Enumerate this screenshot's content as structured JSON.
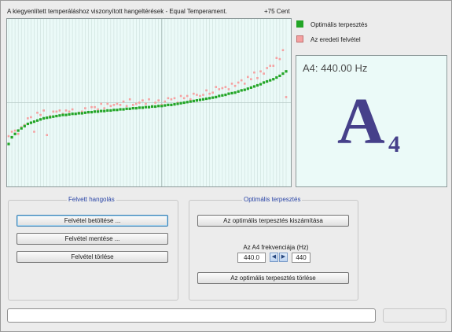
{
  "chart_header": {
    "title": "A kiegyenlített temperáláshoz viszonyított hangeltérések - Equal Temperament.",
    "range_label": "+75 Cent"
  },
  "legend": [
    {
      "label": "Optimális terpesztés",
      "color": "#22a526"
    },
    {
      "label": "Az eredeti felvétel",
      "color": "#f5a0a0"
    }
  ],
  "note_display": {
    "frequency": "A4: 440.00 Hz",
    "letter": "A",
    "octave": "4"
  },
  "recorded_tuning": {
    "legend": "Felvett hangolás",
    "load_button": "Felvétel betöltése ...",
    "save_button": "Felvétel mentése ...",
    "delete_button": "Felvétel törlése"
  },
  "optimal_stretch": {
    "legend": "Optimális terpesztés",
    "calc_button": "Az optimális terpesztés kiszámítása",
    "freq_label": "Az A4 frekvenciája (Hz)",
    "freq_value": "440.0",
    "freq_value_right": "440",
    "delete_button": "Az optimális terpesztés törlése"
  },
  "chart_data": {
    "type": "scatter",
    "title": "A kiegyenlített temperáláshoz viszonyított hangeltérések - Equal Temperament.",
    "ymax_label": "+75 Cent",
    "y_unit": "cent",
    "ylim": [
      -75,
      75
    ],
    "reference_key": 49,
    "x": [
      1,
      2,
      3,
      4,
      5,
      6,
      7,
      8,
      9,
      10,
      11,
      12,
      13,
      14,
      15,
      16,
      17,
      18,
      19,
      20,
      21,
      22,
      23,
      24,
      25,
      26,
      27,
      28,
      29,
      30,
      31,
      32,
      33,
      34,
      35,
      36,
      37,
      38,
      39,
      40,
      41,
      42,
      43,
      44,
      45,
      46,
      47,
      48,
      49,
      50,
      51,
      52,
      53,
      54,
      55,
      56,
      57,
      58,
      59,
      60,
      61,
      62,
      63,
      64,
      65,
      66,
      67,
      68,
      69,
      70,
      71,
      72,
      73,
      74,
      75,
      76,
      77,
      78,
      79,
      80,
      81,
      82,
      83,
      84,
      85,
      86,
      87,
      88
    ],
    "series": [
      {
        "name": "Optimális terpesztés",
        "color": "#22a526",
        "values": [
          -37,
          -31,
          -28,
          -25,
          -23,
          -21,
          -19,
          -18,
          -17,
          -16,
          -15,
          -14,
          -13.5,
          -13,
          -12.5,
          -12,
          -11.5,
          -11,
          -11,
          -10.5,
          -10,
          -10,
          -9.5,
          -9.5,
          -9,
          -8.5,
          -8.5,
          -8,
          -8,
          -7.5,
          -7.5,
          -7,
          -7,
          -6.5,
          -6.5,
          -6,
          -6,
          -5.5,
          -5.5,
          -5,
          -5,
          -4.5,
          -4.5,
          -4,
          -4,
          -3.5,
          -3.5,
          -3,
          -3,
          -2.5,
          -2,
          -2,
          -1.5,
          -1,
          -0.5,
          0,
          0.5,
          1,
          1.5,
          2,
          2.5,
          3,
          3.5,
          4,
          4.5,
          5,
          6,
          6.5,
          7,
          8,
          8.5,
          9,
          10,
          11,
          11.5,
          12.5,
          13.5,
          14.5,
          15.5,
          16.5,
          18,
          19,
          20,
          21,
          22.5,
          24,
          26,
          28
        ]
      },
      {
        "name": "Az eredeti felvétel",
        "color": "#f5a0a0",
        "values": [
          -30,
          -26,
          -25,
          -28,
          -22,
          -20,
          -14,
          -13,
          -26,
          -9,
          -11,
          -7,
          -29,
          -12,
          -8,
          -8,
          -7,
          -10,
          -7,
          -8,
          -6,
          -10,
          -9,
          -8,
          -5,
          -9,
          -4,
          -4,
          -6,
          -1,
          -5,
          -1,
          -3,
          -2,
          -1,
          -2,
          1,
          -3,
          3,
          -2,
          -1,
          0,
          2,
          -1,
          3,
          -3,
          0,
          2,
          -2,
          1,
          4,
          3,
          4,
          0,
          6,
          4,
          6,
          3,
          8,
          7,
          6,
          7,
          11,
          8,
          9,
          14,
          12,
          13,
          14,
          12,
          17,
          15,
          18,
          20,
          17,
          23,
          21,
          27,
          22,
          28,
          26,
          31,
          33,
          33,
          40,
          39,
          47,
          5
        ]
      }
    ]
  }
}
